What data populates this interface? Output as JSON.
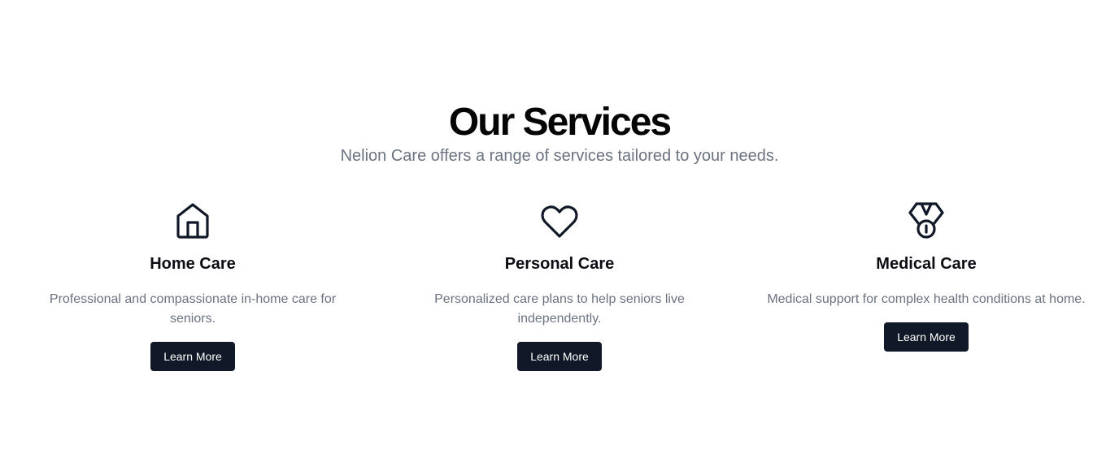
{
  "section": {
    "title": "Our Services",
    "subtitle": "Nelion Care offers a range of services tailored to your needs."
  },
  "services": [
    {
      "icon": "home-icon",
      "title": "Home Care",
      "description": "Professional and compassionate in-home care for seniors.",
      "button_label": "Learn More"
    },
    {
      "icon": "heart-icon",
      "title": "Personal Care",
      "description": "Personalized care plans to help seniors live independently.",
      "button_label": "Learn More"
    },
    {
      "icon": "medal-icon",
      "title": "Medical Care",
      "description": "Medical support for complex health conditions at home.",
      "button_label": "Learn More"
    }
  ],
  "colors": {
    "button_background": "#111827",
    "button_text": "#ffffff",
    "muted_text": "#6b7280",
    "heading_text": "#050505"
  }
}
